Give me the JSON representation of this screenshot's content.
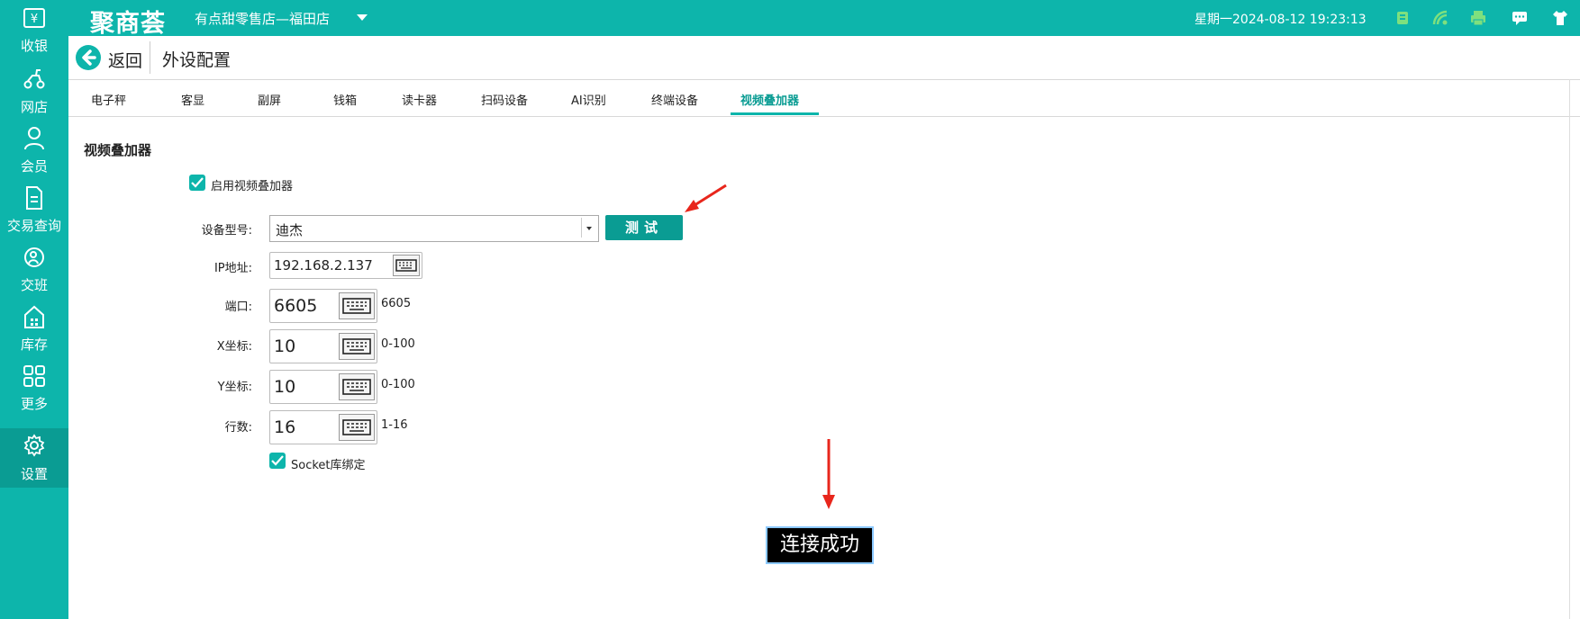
{
  "app": {
    "logo_text": "聚商荟",
    "store_name": "有点甜零售店—福田店",
    "datetime": "星期一2024-08-12 19:23:13"
  },
  "sidebar": {
    "items": [
      {
        "label": "收银",
        "icon": "yen-icon"
      },
      {
        "label": "网店",
        "icon": "scooter-icon"
      },
      {
        "label": "会员",
        "icon": "user-icon"
      },
      {
        "label": "交易查询",
        "icon": "document-icon"
      },
      {
        "label": "交班",
        "icon": "shift-icon"
      },
      {
        "label": "库存",
        "icon": "warehouse-icon"
      },
      {
        "label": "更多",
        "icon": "grid-icon"
      },
      {
        "label": "设置",
        "icon": "gear-icon",
        "active": true
      }
    ]
  },
  "header": {
    "back_label": "返回",
    "title": "外设配置"
  },
  "tabs": [
    {
      "label": "电子秤"
    },
    {
      "label": "客显"
    },
    {
      "label": "副屏"
    },
    {
      "label": "钱箱"
    },
    {
      "label": "读卡器"
    },
    {
      "label": "扫码设备"
    },
    {
      "label": "AI识别"
    },
    {
      "label": "终端设备"
    },
    {
      "label": "视频叠加器",
      "active": true
    }
  ],
  "form": {
    "section_title": "视频叠加器",
    "enable_label": "启用视频叠加器",
    "enable_checked": true,
    "device_model_label": "设备型号:",
    "device_model_value": "迪杰",
    "test_button": "测试",
    "ip_label": "IP地址:",
    "ip_value": "192.168.2.137",
    "port_label": "端口:",
    "port_value": "6605",
    "port_hint": "6605",
    "x_label": "X坐标:",
    "x_value": "10",
    "x_hint": "0-100",
    "y_label": "Y坐标:",
    "y_value": "10",
    "y_hint": "0-100",
    "rows_label": "行数:",
    "rows_value": "16",
    "rows_hint": "1-16",
    "socket_label": "Socket库绑定",
    "socket_checked": true
  },
  "toast": {
    "message": "连接成功"
  },
  "colors": {
    "brand": "#0db5ab",
    "brand_dark": "#0a9c93",
    "annotation_arrow": "#e8261c"
  }
}
